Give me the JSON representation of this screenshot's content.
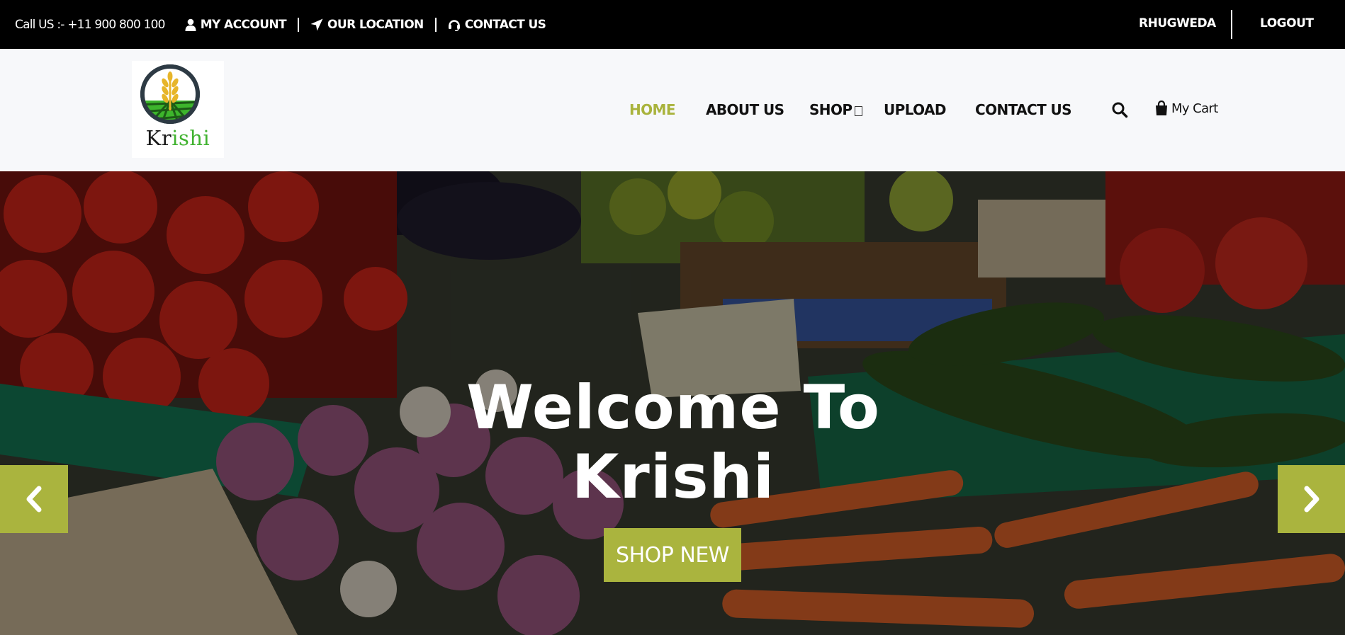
{
  "topbar": {
    "phone": "Call US :- +11 900 800 100",
    "my_account": "MY ACCOUNT",
    "our_location": "OUR LOCATION",
    "contact_us": "CONTACT US",
    "username": "RHUGWEDA",
    "logout": "LOGOUT"
  },
  "logo": {
    "text_dark": "Kr",
    "text_green": "ishi"
  },
  "nav": {
    "home": "HOME",
    "about": "ABOUT US",
    "shop": "SHOP",
    "upload": "UPLOAD",
    "contact": "CONTACT US",
    "cart": "My Cart"
  },
  "hero": {
    "title_line1": "Welcome To",
    "title_line2": "Krishi",
    "button": "SHOP NEW"
  },
  "colors": {
    "accent": "#aab43e",
    "topbar_bg": "#000000",
    "header_bg": "#f7f8fa"
  },
  "icons": [
    "user-icon",
    "location-arrow-icon",
    "headset-icon",
    "search-icon",
    "shopping-bag-icon",
    "chevron-left-icon",
    "chevron-right-icon",
    "caret-down-icon"
  ]
}
